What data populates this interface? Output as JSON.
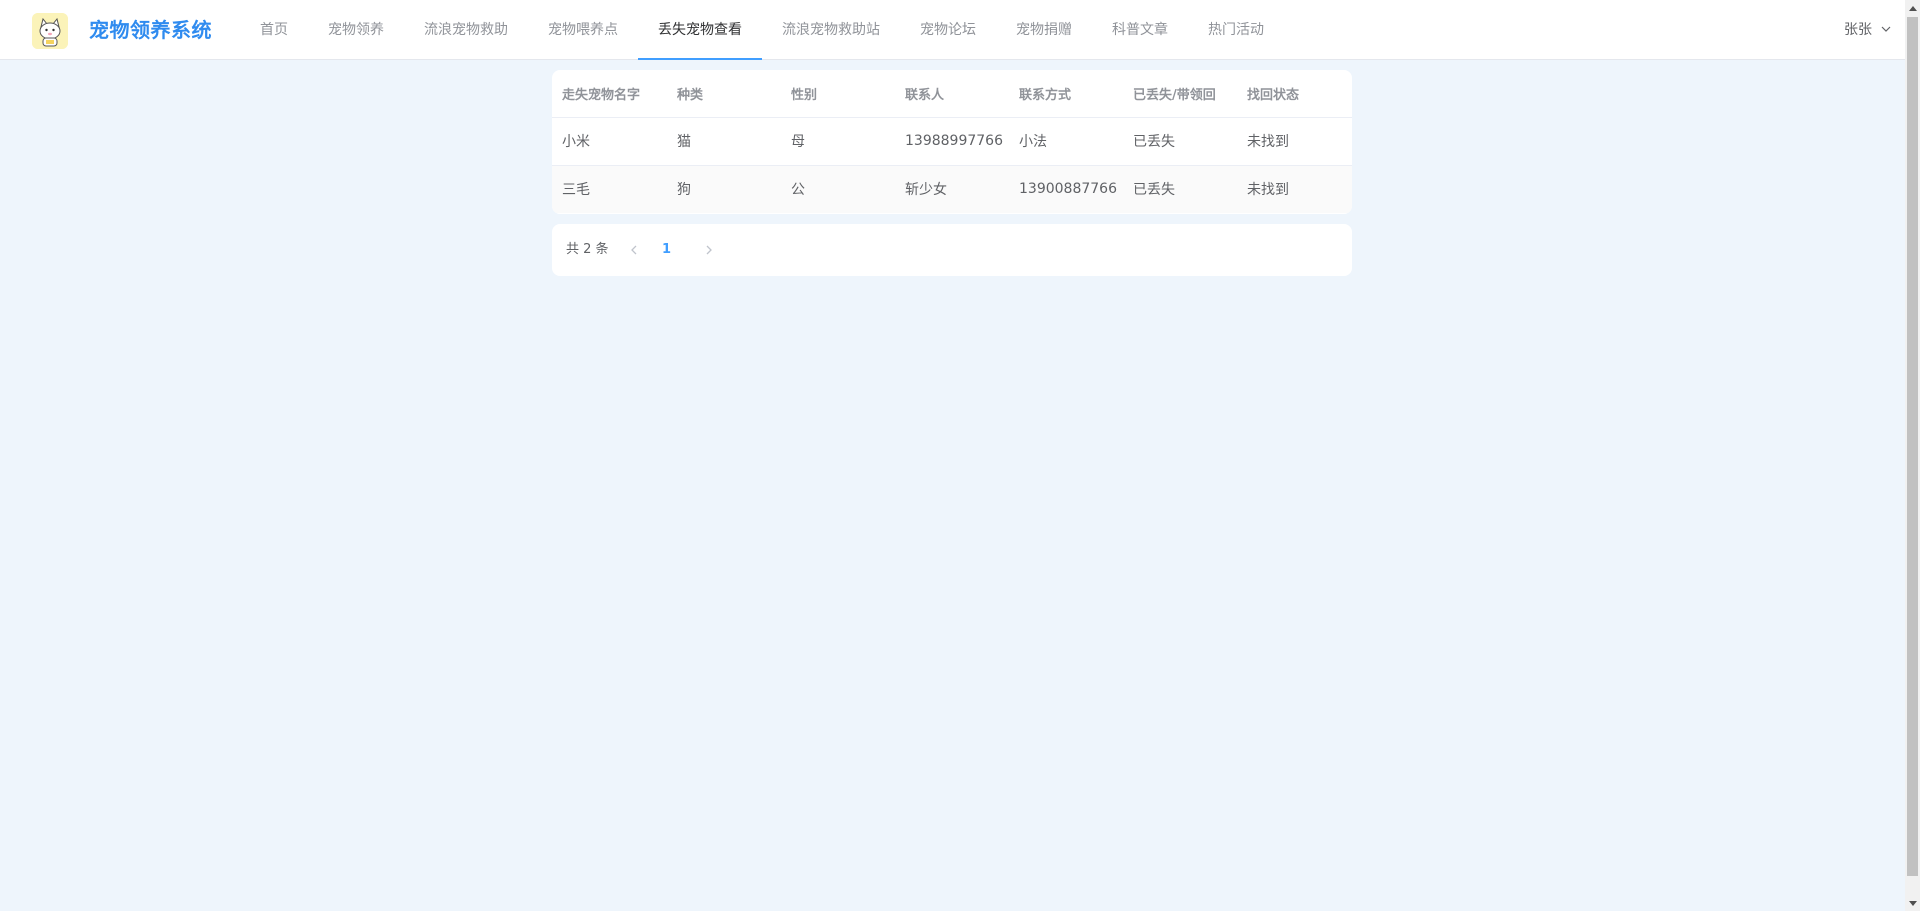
{
  "header": {
    "brand": "宠物领养系统",
    "nav": [
      {
        "label": "首页",
        "active": false
      },
      {
        "label": "宠物领养",
        "active": false
      },
      {
        "label": "流浪宠物救助",
        "active": false
      },
      {
        "label": "宠物喂养点",
        "active": false
      },
      {
        "label": "丢失宠物查看",
        "active": true
      },
      {
        "label": "流浪宠物救助站",
        "active": false
      },
      {
        "label": "宠物论坛",
        "active": false
      },
      {
        "label": "宠物捐赠",
        "active": false
      },
      {
        "label": "科普文章",
        "active": false
      },
      {
        "label": "热门活动",
        "active": false
      }
    ],
    "user": "张张"
  },
  "table": {
    "columns": [
      "走失宠物名字",
      "种类",
      "性别",
      "联系人",
      "联系方式",
      "已丢失/带领回",
      "找回状态"
    ],
    "rows": [
      [
        "小米",
        "猫",
        "母",
        "13988997766",
        "小法",
        "已丢失",
        "未找到"
      ],
      [
        "三毛",
        "狗",
        "公",
        "斩少女",
        "13900887766",
        "已丢失",
        "未找到"
      ]
    ]
  },
  "pagination": {
    "total": "共 2 条",
    "current": "1"
  },
  "colors": {
    "accent": "#409eff",
    "brand": "#2f8bef",
    "background": "#eef5fc"
  }
}
